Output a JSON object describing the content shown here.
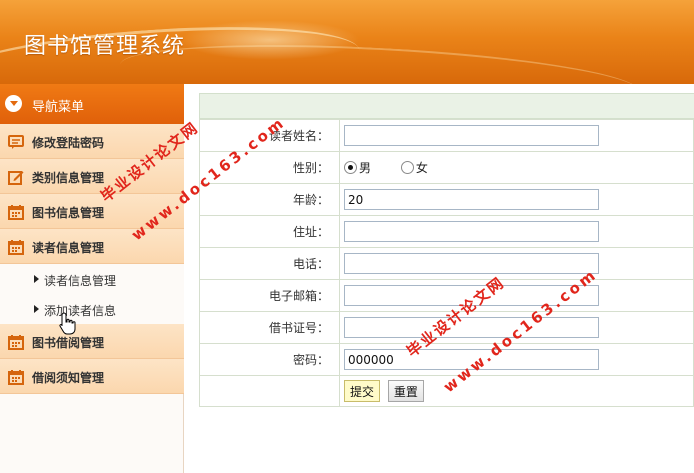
{
  "header": {
    "title": "图书馆管理系统"
  },
  "sidebar": {
    "nav_title": "导航菜单",
    "items": [
      {
        "label": "修改登陆密码",
        "icon": "chat-icon"
      },
      {
        "label": "类别信息管理",
        "icon": "edit-icon"
      },
      {
        "label": "图书信息管理",
        "icon": "calendar-icon"
      },
      {
        "label": "读者信息管理",
        "icon": "calendar-icon"
      },
      {
        "label": "图书借阅管理",
        "icon": "calendar-icon"
      },
      {
        "label": "借阅须知管理",
        "icon": "calendar-icon"
      }
    ],
    "subitems": [
      {
        "label": "读者信息管理"
      },
      {
        "label": "添加读者信息"
      }
    ]
  },
  "form": {
    "fields": [
      {
        "label": "读者姓名：",
        "value": ""
      },
      {
        "label": "性别："
      },
      {
        "label": "年龄：",
        "value": "20"
      },
      {
        "label": "住址：",
        "value": ""
      },
      {
        "label": "电话：",
        "value": ""
      },
      {
        "label": "电子邮箱：",
        "value": ""
      },
      {
        "label": "借书证号：",
        "value": ""
      },
      {
        "label": "密码：",
        "value": "000000"
      }
    ],
    "gender": {
      "male": "男",
      "female": "女",
      "selected": "男"
    },
    "submit_label": "提交",
    "reset_label": "重置"
  },
  "watermark": {
    "line1": "毕业设计论文网",
    "line2": "www.doc163.com"
  },
  "colors": {
    "header_orange": "#ea8318",
    "nav_head": "#e0600a",
    "menu_bg": "#fbd7ae",
    "watermark_red": "#e1261c"
  }
}
